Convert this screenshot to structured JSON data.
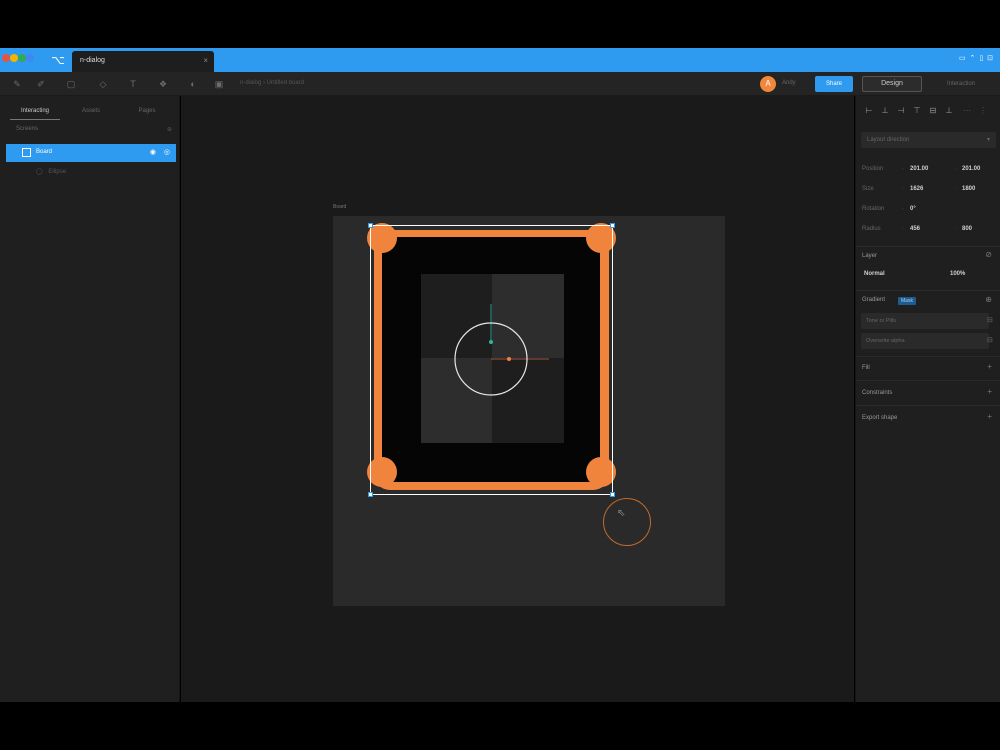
{
  "app": {
    "tab_title": "n-dialog",
    "tab_close": "×",
    "window_controls": "▭ ⌃ ▯ ⊡",
    "brand_colors": {
      "accent": "#2f9bf0",
      "orange": "#f0843c",
      "logo_dots": [
        "#e8533b",
        "#f4b400",
        "#34a853",
        "#4285f4"
      ]
    }
  },
  "toolbar": {
    "tools": [
      "pen-icon",
      "pencil-icon",
      "frame-icon",
      "shape-icon",
      "text-icon",
      "component-icon",
      "mask-icon",
      "image-icon"
    ],
    "breadcrumb": "n-dialog › Untitled board",
    "avatar_initial": "A",
    "user_label": "Andy",
    "share_label": "Share",
    "design_label": "Design",
    "interact_label": "Interaction"
  },
  "left_panel": {
    "tabs": [
      "Interacting",
      "Assets",
      "Pages"
    ],
    "active_tab": 0,
    "page_label": "Screens",
    "layers": {
      "selected": "Board",
      "child": "Ellipse"
    }
  },
  "canvas": {
    "board_label": "Board"
  },
  "right_panel": {
    "align_icons": [
      "align-left-icon",
      "align-center-icon",
      "align-right-icon",
      "align-top-icon",
      "align-middle-icon",
      "align-bottom-icon",
      "distribute-h-icon",
      "distribute-v-icon"
    ],
    "layout_select": "Layout direction",
    "position": {
      "label": "Position",
      "x": "201.00",
      "y": "201.00"
    },
    "size": {
      "label": "Size",
      "w": "1626",
      "h": "1800"
    },
    "rotation": {
      "label": "Rotation",
      "value": "0°"
    },
    "radius": {
      "label": "Radius",
      "a": "456",
      "b": "800"
    },
    "layer": {
      "title": "Layer",
      "blend": "Normal",
      "opacity": "100%"
    },
    "effects": {
      "title": "Gradient",
      "badge": "Mask",
      "items": [
        "Tone or Pills",
        "Overwrite alpha"
      ]
    },
    "sections": [
      "Fill",
      "Constraints",
      "Export shape"
    ]
  }
}
